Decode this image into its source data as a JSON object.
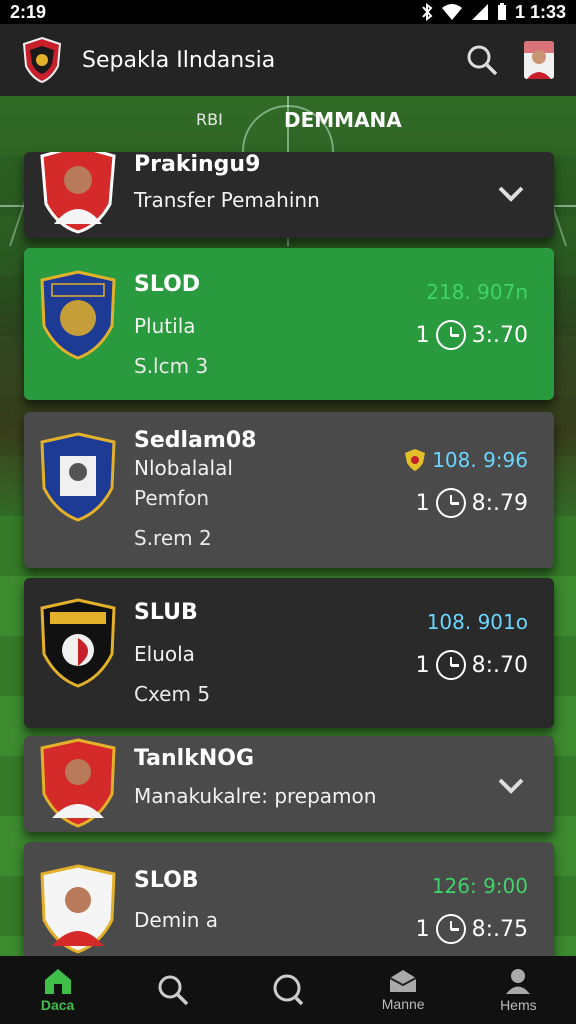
{
  "status_bar": {
    "time_left": "2:19",
    "time_right": "1 1:33"
  },
  "app_bar": {
    "title": "Sepakla Ilndansia"
  },
  "banner": {
    "left": "RBI",
    "right": "DEMMANA"
  },
  "cards": [
    {
      "title": "Prakingu9",
      "subtitle": "Transfer Pemahinn",
      "style": "dark"
    },
    {
      "title": "SLOD",
      "line2": "Plutila",
      "line3": "S.lcm 3",
      "price": "218. 907n",
      "price_color": "#3fd36a",
      "time": "3:.70",
      "time_prefix": "1",
      "style": "green"
    },
    {
      "title": "Sedlam08",
      "line2": "Nlobalalal",
      "line3": "Pemfon",
      "line4": "S.rem 2",
      "price": "108. 9:96",
      "price_color": "#6ad6ff",
      "time": "8:.79",
      "time_prefix": "1",
      "style": "gray"
    },
    {
      "title": "SLUB",
      "line2": "Eluola",
      "line3": "Cxem 5",
      "price": "108. 901o",
      "price_color": "#6ad6ff",
      "time": "8:.70",
      "time_prefix": "1",
      "style": "dark"
    },
    {
      "title": "TanlkNOG",
      "subtitle": "Manakukalre: prepamon",
      "style": "gray"
    },
    {
      "title": "SLOB",
      "line2": "Demin a",
      "price": "126: 9:00",
      "price_color": "#3fd36a",
      "time": "8:.75",
      "time_prefix": "1",
      "style": "gray"
    }
  ],
  "bottom_nav": [
    {
      "label": "Daca",
      "icon": "home-icon",
      "active": true
    },
    {
      "label": "",
      "icon": "search-icon",
      "active": false
    },
    {
      "label": "",
      "icon": "search-icon",
      "active": false
    },
    {
      "label": "Manne",
      "icon": "inbox-icon",
      "active": false
    },
    {
      "label": "Hems",
      "icon": "profile-icon",
      "active": false
    }
  ],
  "colors": {
    "accent_green": "#2a9a3e",
    "card_dark": "#2a2a2a",
    "card_gray": "#4a4a4a",
    "active_nav": "#3fbf4a"
  }
}
